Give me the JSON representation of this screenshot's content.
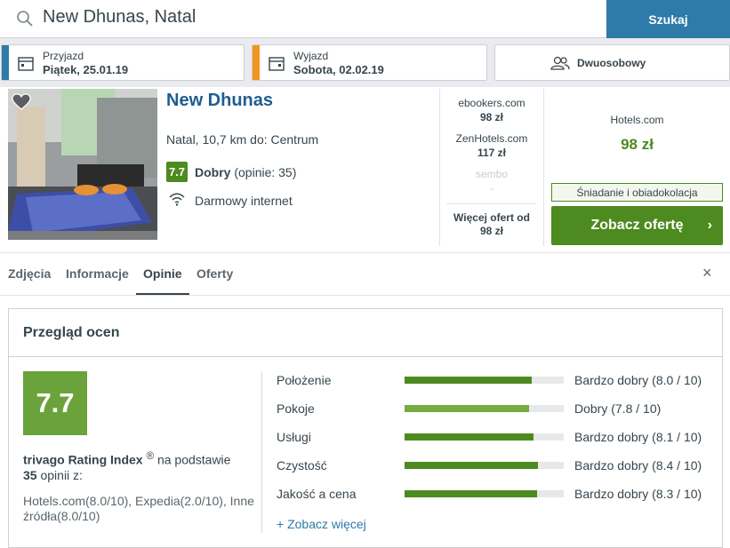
{
  "search": {
    "value": "New Dhunas, Natal",
    "button_label": "Szukaj"
  },
  "dates": {
    "checkin_label": "Przyjazd",
    "checkin_value": "Piątek, 25.01.19",
    "checkout_label": "Wyjazd",
    "checkout_value": "Sobota, 02.02.19"
  },
  "guests": {
    "label": "Dwuosobowy"
  },
  "hotel": {
    "name": "New Dhunas",
    "location": "Natal, 10,7 km do: Centrum",
    "score": "7.7",
    "rating_label": "Dobry",
    "rating_reviews": "(opinie: 35)",
    "amenity": "Darmowy internet"
  },
  "offers": [
    {
      "site": "ebookers.com",
      "price": "98 zł"
    },
    {
      "site": "ZenHotels.com",
      "price": "117 zł"
    },
    {
      "site": "sembo",
      "price": "-"
    }
  ],
  "more_offers": {
    "line1": "Więcej ofert od",
    "line2": "98 zł"
  },
  "best_offer": {
    "site": "Hotels.com",
    "price": "98 zł",
    "breakfast": "Śniadanie i obiadokolacja",
    "button_label": "Zobacz ofertę",
    "chevron": "›"
  },
  "tabs": [
    "Zdjęcia",
    "Informacje",
    "Opinie",
    "Oferty"
  ],
  "active_tab": "Opinie",
  "close_symbol": "×",
  "reviews": {
    "title": "Przegląd ocen",
    "score": "7.7",
    "index_label": "trivago Rating Index",
    "index_sup": "®",
    "index_text": "na podstawie",
    "index_count": "35",
    "index_suffix": "opinii z:",
    "sources": "Hotels.com(8.0/10), Expedia(2.0/10), Inne źródła(8.0/10)",
    "categories": [
      {
        "label": "Położenie",
        "rating": "Bardzo dobry",
        "score": "(8.0 / 10)",
        "value": 8.0
      },
      {
        "label": "Pokoje",
        "rating": "Dobry",
        "score": "(7.8 / 10)",
        "value": 7.8
      },
      {
        "label": "Usługi",
        "rating": "Bardzo dobry",
        "score": "(8.1 / 10)",
        "value": 8.1
      },
      {
        "label": "Czystość",
        "rating": "Bardzo dobry",
        "score": "(8.4 / 10)",
        "value": 8.4
      },
      {
        "label": "Jakość a cena",
        "rating": "Bardzo dobry",
        "score": "(8.3 / 10)",
        "value": 8.3
      }
    ],
    "see_more": "+ Zobacz więcej"
  },
  "colors": {
    "accent_blue": "#2e7aa8",
    "green": "#4d8a1f",
    "checkin_stripe": "#2e7aa8",
    "checkout_stripe": "#f0961e",
    "bar_dark": "#4d8a1f",
    "bar_light": "#75ab43"
  }
}
